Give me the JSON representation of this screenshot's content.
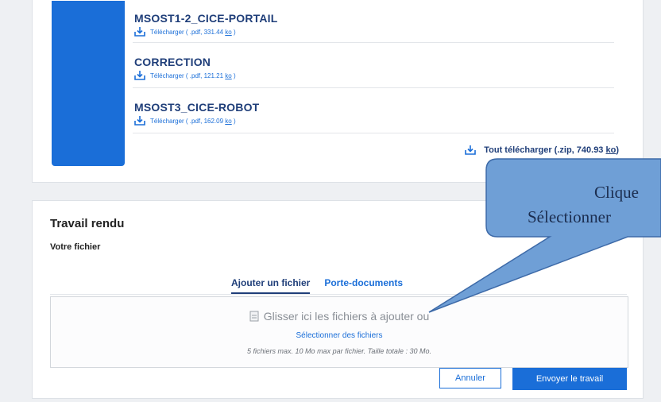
{
  "documents": [
    {
      "title": "MSOST1-2_CICE-PORTAIL",
      "download_prefix": "Télécharger ( .pdf, 331.44 ",
      "unit": "ko",
      "suffix": " )"
    },
    {
      "title": "CORRECTION",
      "download_prefix": "Télécharger ( .pdf, 121.21 ",
      "unit": "ko",
      "suffix": " )"
    },
    {
      "title": "MSOST3_CICE-ROBOT",
      "download_prefix": "Télécharger ( .pdf, 162.09 ",
      "unit": "ko",
      "suffix": " )"
    }
  ],
  "download_all": {
    "prefix": "Tout télécharger (.zip, 740.93 ",
    "unit": "ko",
    "suffix": ")"
  },
  "work": {
    "title": "Travail rendu",
    "file_label": "Votre fichier",
    "tabs": [
      "Ajouter un fichier",
      "Porte-documents"
    ],
    "dropzone": {
      "drag_text": "Glisser ici les fichiers à ajouter ou",
      "select_link": "Sélectionner des fichiers",
      "limits": "5 fichiers max. 10 Mo max par fichier. Taille totale : 30 Mo."
    },
    "cancel_label": "Annuler",
    "send_label": "Envoyer le travail"
  },
  "callout": {
    "line1": "Clique",
    "line2": "Sélectionner"
  },
  "colors": {
    "primary": "#1a6ed8",
    "title_dark": "#1f3e79",
    "callout_fill": "#6f9fd6",
    "callout_stroke": "#3d6aa8"
  }
}
